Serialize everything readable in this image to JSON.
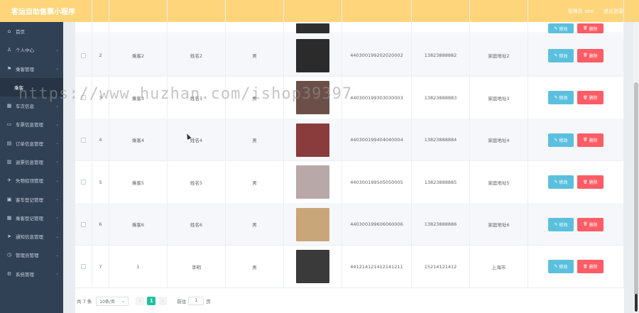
{
  "header": {
    "title": "客运自助售票小程序",
    "admin_label": "管理员 abo",
    "logout_label": "退出登录"
  },
  "sidebar": {
    "items": [
      {
        "icon": "home-icon",
        "glyph": "⌂",
        "label": "首页",
        "has_arrow": false
      },
      {
        "icon": "user-icon",
        "glyph": "♙",
        "label": "个人中心",
        "has_arrow": true
      },
      {
        "icon": "flag-icon",
        "glyph": "⚑",
        "label": "乘客管理",
        "has_arrow": true
      },
      {
        "icon": "",
        "glyph": "",
        "label": "乘客",
        "sub": true
      },
      {
        "icon": "grid-icon",
        "glyph": "▦",
        "label": "车次信息",
        "has_arrow": true
      },
      {
        "icon": "ticket-icon",
        "glyph": "▭",
        "label": "车票信息管理",
        "has_arrow": true
      },
      {
        "icon": "order-icon",
        "glyph": "▤",
        "label": "订单信息管理",
        "has_arrow": true
      },
      {
        "icon": "refund-icon",
        "glyph": "▥",
        "label": "退票信息管理",
        "has_arrow": true
      },
      {
        "icon": "lost-icon",
        "glyph": "✈",
        "label": "失物招领管理",
        "has_arrow": true
      },
      {
        "icon": "bus-icon",
        "glyph": "▣",
        "label": "客车登记管理",
        "has_arrow": true
      },
      {
        "icon": "register-icon",
        "glyph": "▦",
        "label": "乘客登记管理",
        "has_arrow": true
      },
      {
        "icon": "notice-icon",
        "glyph": "➤",
        "label": "通知信息管理",
        "has_arrow": true
      },
      {
        "icon": "manager-icon",
        "glyph": "◷",
        "label": "管理员管理",
        "has_arrow": true
      },
      {
        "icon": "system-icon",
        "glyph": "⚙",
        "label": "系统管理",
        "has_arrow": true
      }
    ]
  },
  "table": {
    "rows": [
      {
        "index": "2",
        "account": "乘客2",
        "name": "姓名2",
        "gender": "男",
        "id_no": "440300199202020002",
        "phone": "13823888882",
        "address": "家庭地址2",
        "photo_color": "#2b2b2b"
      },
      {
        "index": "3",
        "account": "乘客3",
        "name": "姓名3",
        "gender": "男",
        "id_no": "440300199303030003",
        "phone": "13823888883",
        "address": "家庭地址3",
        "photo_color": "#6b4f48"
      },
      {
        "index": "4",
        "account": "乘客4",
        "name": "姓名4",
        "gender": "男",
        "id_no": "440300199404040004",
        "phone": "13823888884",
        "address": "家庭地址4",
        "photo_color": "#8a3b3b"
      },
      {
        "index": "5",
        "account": "乘客5",
        "name": "姓名5",
        "gender": "男",
        "id_no": "440300199505050005",
        "phone": "13823888885",
        "address": "家庭地址5",
        "photo_color": "#b8a8a8"
      },
      {
        "index": "6",
        "account": "乘客6",
        "name": "姓名6",
        "gender": "男",
        "id_no": "440300199606060006",
        "phone": "13823888886",
        "address": "家庭地址6",
        "photo_color": "#c9a67a"
      },
      {
        "index": "7",
        "account": "1",
        "name": "李明",
        "gender": "男",
        "id_no": "441214121412141211",
        "phone": "15214121412",
        "address": "上海市",
        "photo_color": "#3a3a3a"
      }
    ],
    "edit_label": "修改",
    "delete_label": "删除"
  },
  "pagination": {
    "total_label": "共 7 条",
    "page_size": "10条/页",
    "current_page": "1",
    "goto_label": "前往",
    "goto_value": "1",
    "page_suffix": "页"
  },
  "watermark": "https://www.huzhan.com/ishop39397"
}
